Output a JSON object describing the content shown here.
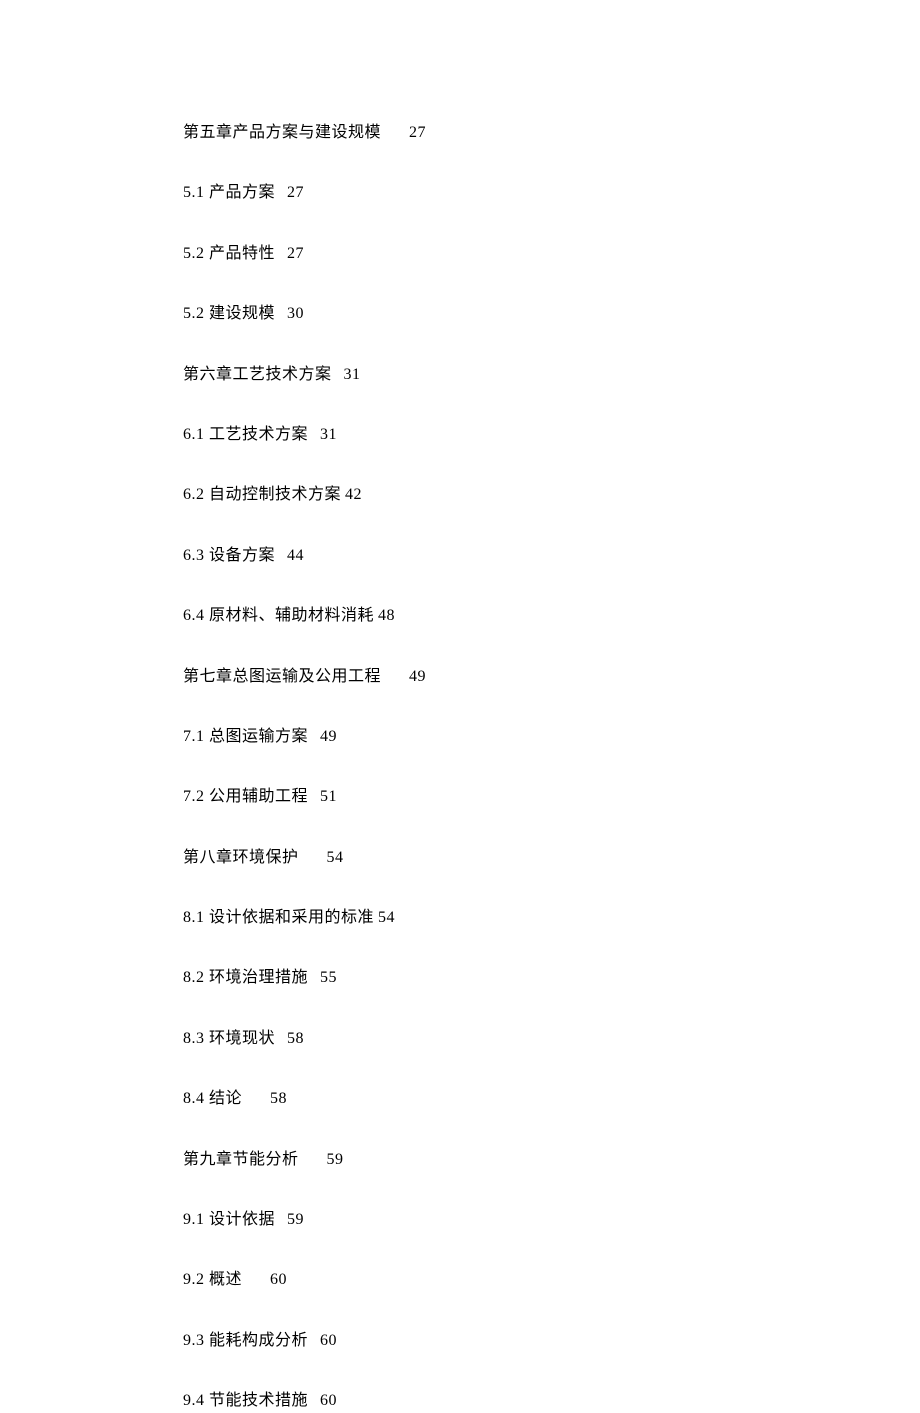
{
  "toc": [
    {
      "text": "第五章产品方案与建设规模",
      "page": "27",
      "spacing": "wide"
    },
    {
      "text": "5.1 产品方案",
      "page": "27",
      "spacing": "normal"
    },
    {
      "text": "5.2 产品特性",
      "page": "27",
      "spacing": "normal"
    },
    {
      "text": "5.2 建设规模",
      "page": "30",
      "spacing": "normal"
    },
    {
      "text": "第六章工艺技术方案",
      "page": "31",
      "spacing": "normal"
    },
    {
      "text": "6.1 工艺技术方案",
      "page": "31",
      "spacing": "normal"
    },
    {
      "text": "6.2 自动控制技术方案",
      "page": "42",
      "spacing": "narrow"
    },
    {
      "text": "6.3 设备方案",
      "page": "44",
      "spacing": "normal"
    },
    {
      "text": "6.4 原材料、辅助材料消耗",
      "page": "48",
      "spacing": "narrow"
    },
    {
      "text": "第七章总图运输及公用工程",
      "page": "49",
      "spacing": "wide"
    },
    {
      "text": "7.1 总图运输方案",
      "page": "49",
      "spacing": "normal"
    },
    {
      "text": "7.2 公用辅助工程",
      "page": "51",
      "spacing": "normal"
    },
    {
      "text": "第八章环境保护",
      "page": "54",
      "spacing": "wide"
    },
    {
      "text": "8.1 设计依据和采用的标准",
      "page": "54",
      "spacing": "narrow"
    },
    {
      "text": "8.2 环境治理措施",
      "page": "55",
      "spacing": "normal"
    },
    {
      "text": "8.3 环境现状",
      "page": "58",
      "spacing": "normal"
    },
    {
      "text": "8.4 结论",
      "page": "58",
      "spacing": "wide"
    },
    {
      "text": "第九章节能分析",
      "page": "59",
      "spacing": "wide"
    },
    {
      "text": "9.1 设计依据",
      "page": "59",
      "spacing": "normal"
    },
    {
      "text": "9.2 概述",
      "page": "60",
      "spacing": "wide"
    },
    {
      "text": "9.3 能耗构成分析",
      "page": "60",
      "spacing": "normal"
    },
    {
      "text": "9.4 节能技术措施",
      "page": "60",
      "spacing": "normal"
    }
  ]
}
